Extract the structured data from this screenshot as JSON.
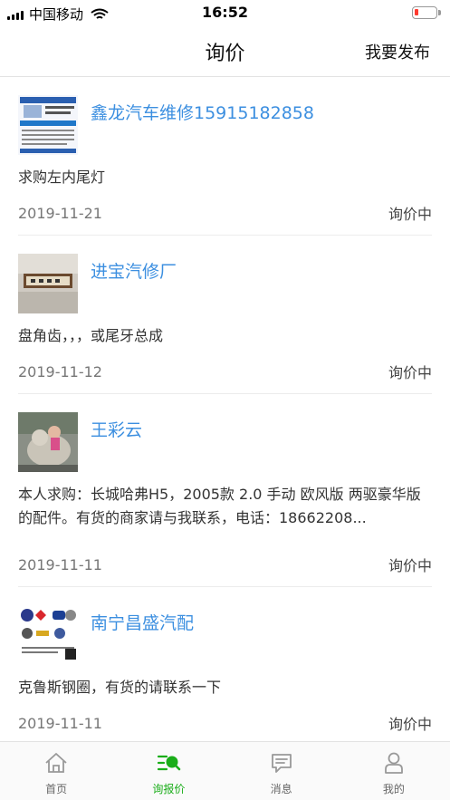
{
  "status_bar": {
    "carrier": "中国移动",
    "time": "16:52",
    "battery_color": "#ff3b30"
  },
  "nav": {
    "title": "询价",
    "action": "我要发布"
  },
  "inquiries": [
    {
      "shop": "鑫龙汽车维修15915182858",
      "content": "求购左内尾灯",
      "date": "2019-11-21",
      "status": "询价中"
    },
    {
      "shop": "进宝汽修厂",
      "content": "盘角齿，，，或尾牙总成",
      "date": "2019-11-12",
      "status": "询价中"
    },
    {
      "shop": "王彩云",
      "content": "本人求购：长城哈弗H5，2005款 2.0 手动 欧风版 两驱豪华版的配件。有货的商家请与我联系，电话：18662208...",
      "date": "2019-11-11",
      "status": "询价中"
    },
    {
      "shop": "南宁昌盛汽配",
      "content": "克鲁斯钢圈，有货的请联系一下",
      "date": "2019-11-11",
      "status": "询价中"
    }
  ],
  "tabs": [
    {
      "label": "首页",
      "icon": "home-icon"
    },
    {
      "label": "询报价",
      "icon": "inquiry-search-icon"
    },
    {
      "label": "消息",
      "icon": "message-icon"
    },
    {
      "label": "我的",
      "icon": "profile-icon"
    }
  ],
  "colors": {
    "accent": "#1aad19",
    "link": "#3c8fe0"
  }
}
